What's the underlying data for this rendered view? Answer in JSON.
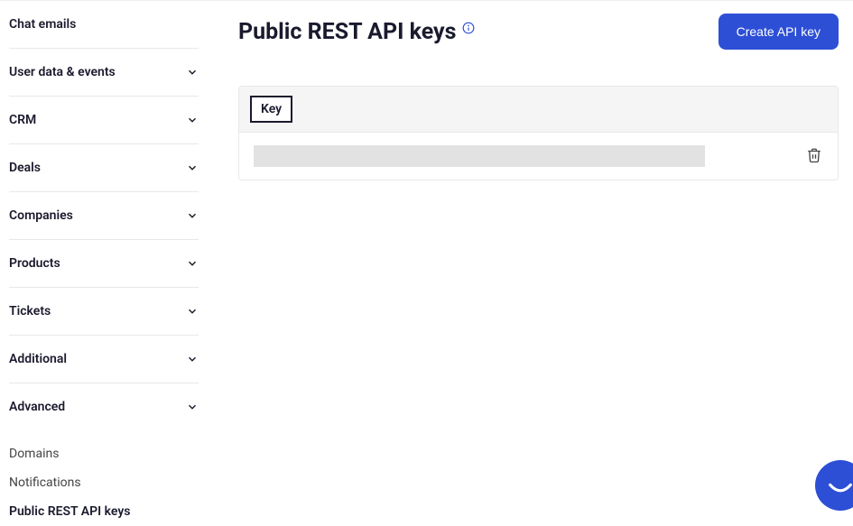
{
  "sidebar": {
    "items": [
      {
        "label": "Chat emails",
        "expandable": false
      },
      {
        "label": "User data & events",
        "expandable": true
      },
      {
        "label": "CRM",
        "expandable": true
      },
      {
        "label": "Deals",
        "expandable": true
      },
      {
        "label": "Companies",
        "expandable": true
      },
      {
        "label": "Products",
        "expandable": true
      },
      {
        "label": "Tickets",
        "expandable": true
      },
      {
        "label": "Additional",
        "expandable": true
      },
      {
        "label": "Advanced",
        "expandable": true,
        "expanded": true
      }
    ],
    "advanced_subitems": [
      {
        "label": "Domains",
        "active": false
      },
      {
        "label": "Notifications",
        "active": false
      },
      {
        "label": "Public REST API keys",
        "active": true
      }
    ]
  },
  "header": {
    "title": "Public REST API keys",
    "create_button_label": "Create API key"
  },
  "table": {
    "column_header": "Key",
    "rows": [
      {
        "key_masked": true
      }
    ]
  }
}
